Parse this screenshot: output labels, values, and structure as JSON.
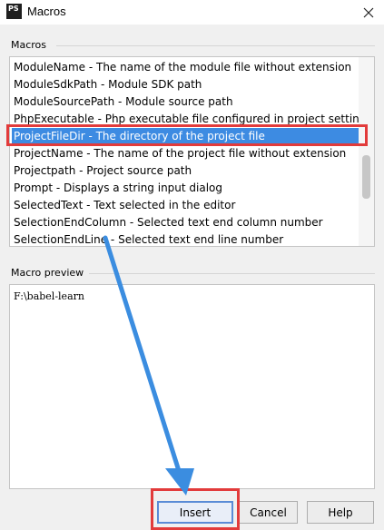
{
  "window": {
    "title": "Macros",
    "app_icon_text": "PS",
    "close_icon": "close-icon"
  },
  "macros_section": {
    "label": "Macros",
    "items": [
      "ModuleName - The name of the module file without extension",
      "ModuleSdkPath - Module SDK path",
      "ModuleSourcePath - Module source path",
      "PhpExecutable - Php executable file configured in project settings",
      "ProjectFileDir - The directory of the project file",
      "ProjectName - The name of the project file without extension",
      "Projectpath - Project source path",
      "Prompt - Displays a string input dialog",
      "SelectedText - Text selected in the editor",
      "SelectionEndColumn - Selected text end column number",
      "SelectionEndLine - Selected text end line number"
    ],
    "selected_index": 4
  },
  "preview_section": {
    "label": "Macro preview",
    "value": "F:\\babel-learn"
  },
  "buttons": {
    "insert": "Insert",
    "cancel": "Cancel",
    "help": "Help"
  },
  "colors": {
    "selection": "#3d8be2",
    "annotation": "#e23b3b",
    "arrow": "#3b8de0"
  }
}
